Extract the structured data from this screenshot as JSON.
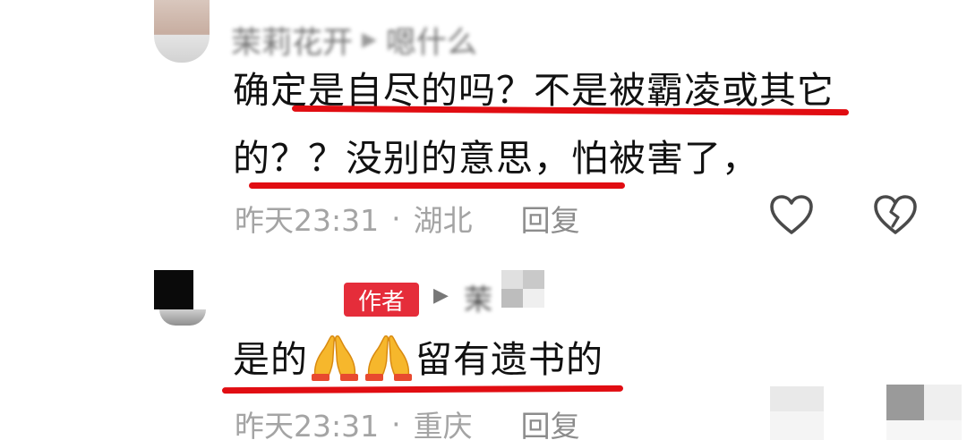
{
  "comments": [
    {
      "username": "茉莉花开",
      "reply_to": "嗯什么",
      "lines": [
        "确定是自尽的吗？不是被霸凌或其它",
        "的？？没别的意思，怕被害了，"
      ],
      "time": "昨天23:31",
      "location": "湖北",
      "reply_label": "回复",
      "icons": [
        "heart-icon",
        "broken-heart-icon"
      ]
    },
    {
      "badge": "作者",
      "reply_to": "茉",
      "text_before": "是的",
      "emoji": "pray-emoji",
      "text_after": "留有遗书的",
      "time": "昨天23:31",
      "location": "重庆",
      "reply_label": "回复"
    }
  ],
  "colors": {
    "underline": "#e10d12",
    "author_badge": "#e52d3a",
    "meta_text": "#a4a4a4"
  }
}
